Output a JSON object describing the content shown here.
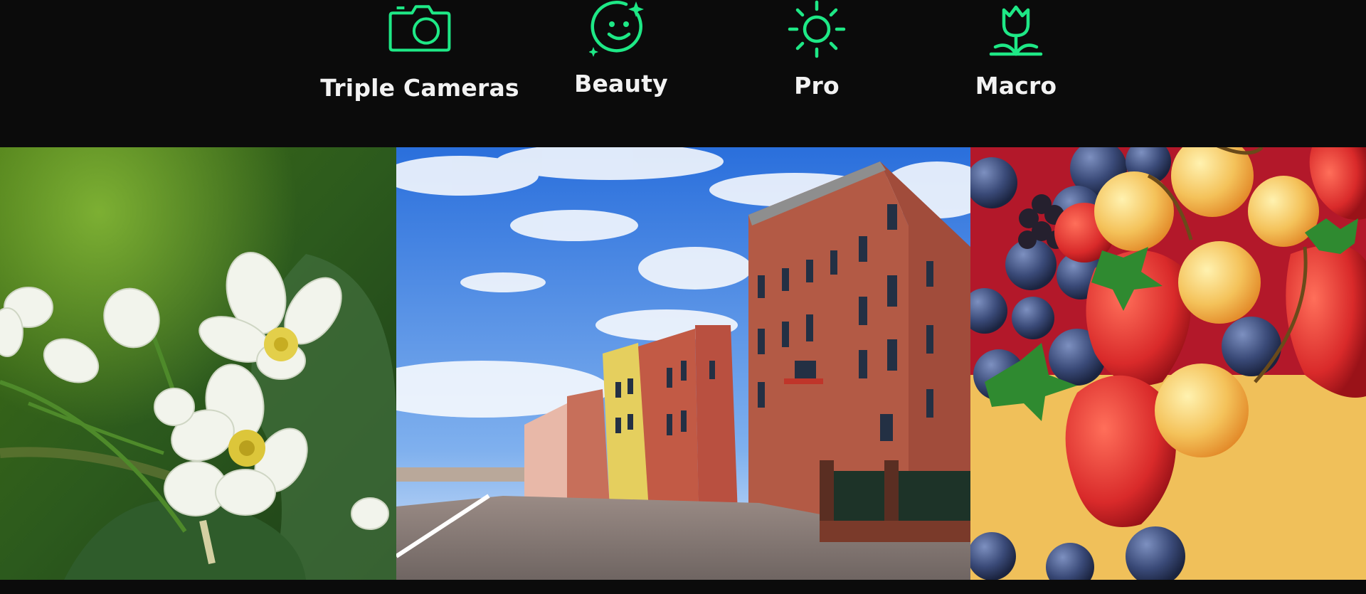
{
  "accent_color": "#1ee886",
  "features": [
    {
      "label": "Triple Cameras",
      "icon": "camera-icon"
    },
    {
      "label": "Beauty",
      "icon": "smiley-face-icon"
    },
    {
      "label": "Pro",
      "icon": "sun-icon"
    },
    {
      "label": "Macro",
      "icon": "tulip-flower-icon"
    }
  ],
  "photos": [
    {
      "subject": "white-flowers"
    },
    {
      "subject": "city-street-buildings"
    },
    {
      "subject": "fruit-berries"
    }
  ]
}
